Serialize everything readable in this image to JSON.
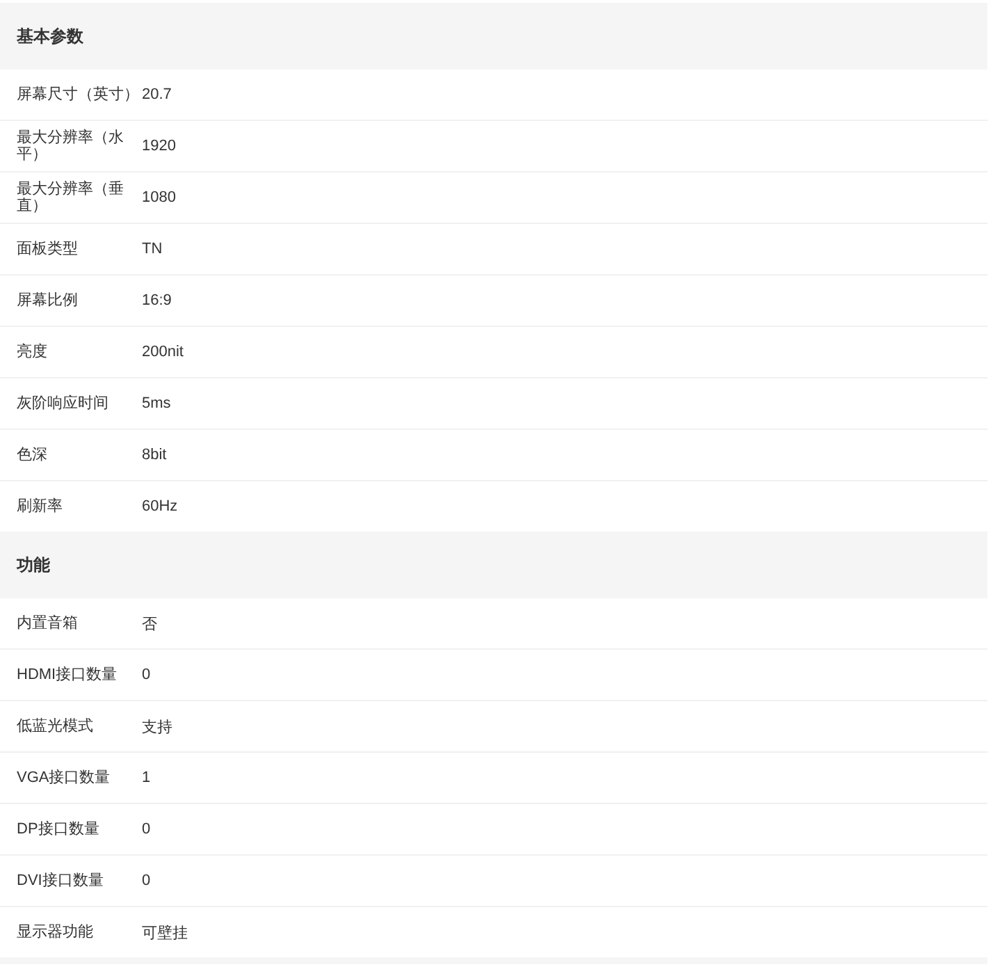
{
  "sections": [
    {
      "title": "基本参数",
      "rows": [
        {
          "label": "屏幕尺寸（英寸）",
          "value": "20.7"
        },
        {
          "label": "最大分辨率（水平）",
          "value": "1920"
        },
        {
          "label": "最大分辨率（垂直）",
          "value": "1080"
        },
        {
          "label": "面板类型",
          "value": "TN"
        },
        {
          "label": "屏幕比例",
          "value": "16:9"
        },
        {
          "label": "亮度",
          "value": "200nit"
        },
        {
          "label": "灰阶响应时间",
          "value": "5ms"
        },
        {
          "label": "色深",
          "value": "8bit"
        },
        {
          "label": "刷新率",
          "value": "60Hz"
        }
      ]
    },
    {
      "title": "功能",
      "rows": [
        {
          "label": "内置音箱",
          "value": "否"
        },
        {
          "label": "HDMI接口数量",
          "value": "0"
        },
        {
          "label": "低蓝光模式",
          "value": "支持"
        },
        {
          "label": "VGA接口数量",
          "value": "1"
        },
        {
          "label": "DP接口数量",
          "value": "0"
        },
        {
          "label": "DVI接口数量",
          "value": "0"
        },
        {
          "label": "显示器功能",
          "value": "可壁挂"
        }
      ]
    }
  ]
}
